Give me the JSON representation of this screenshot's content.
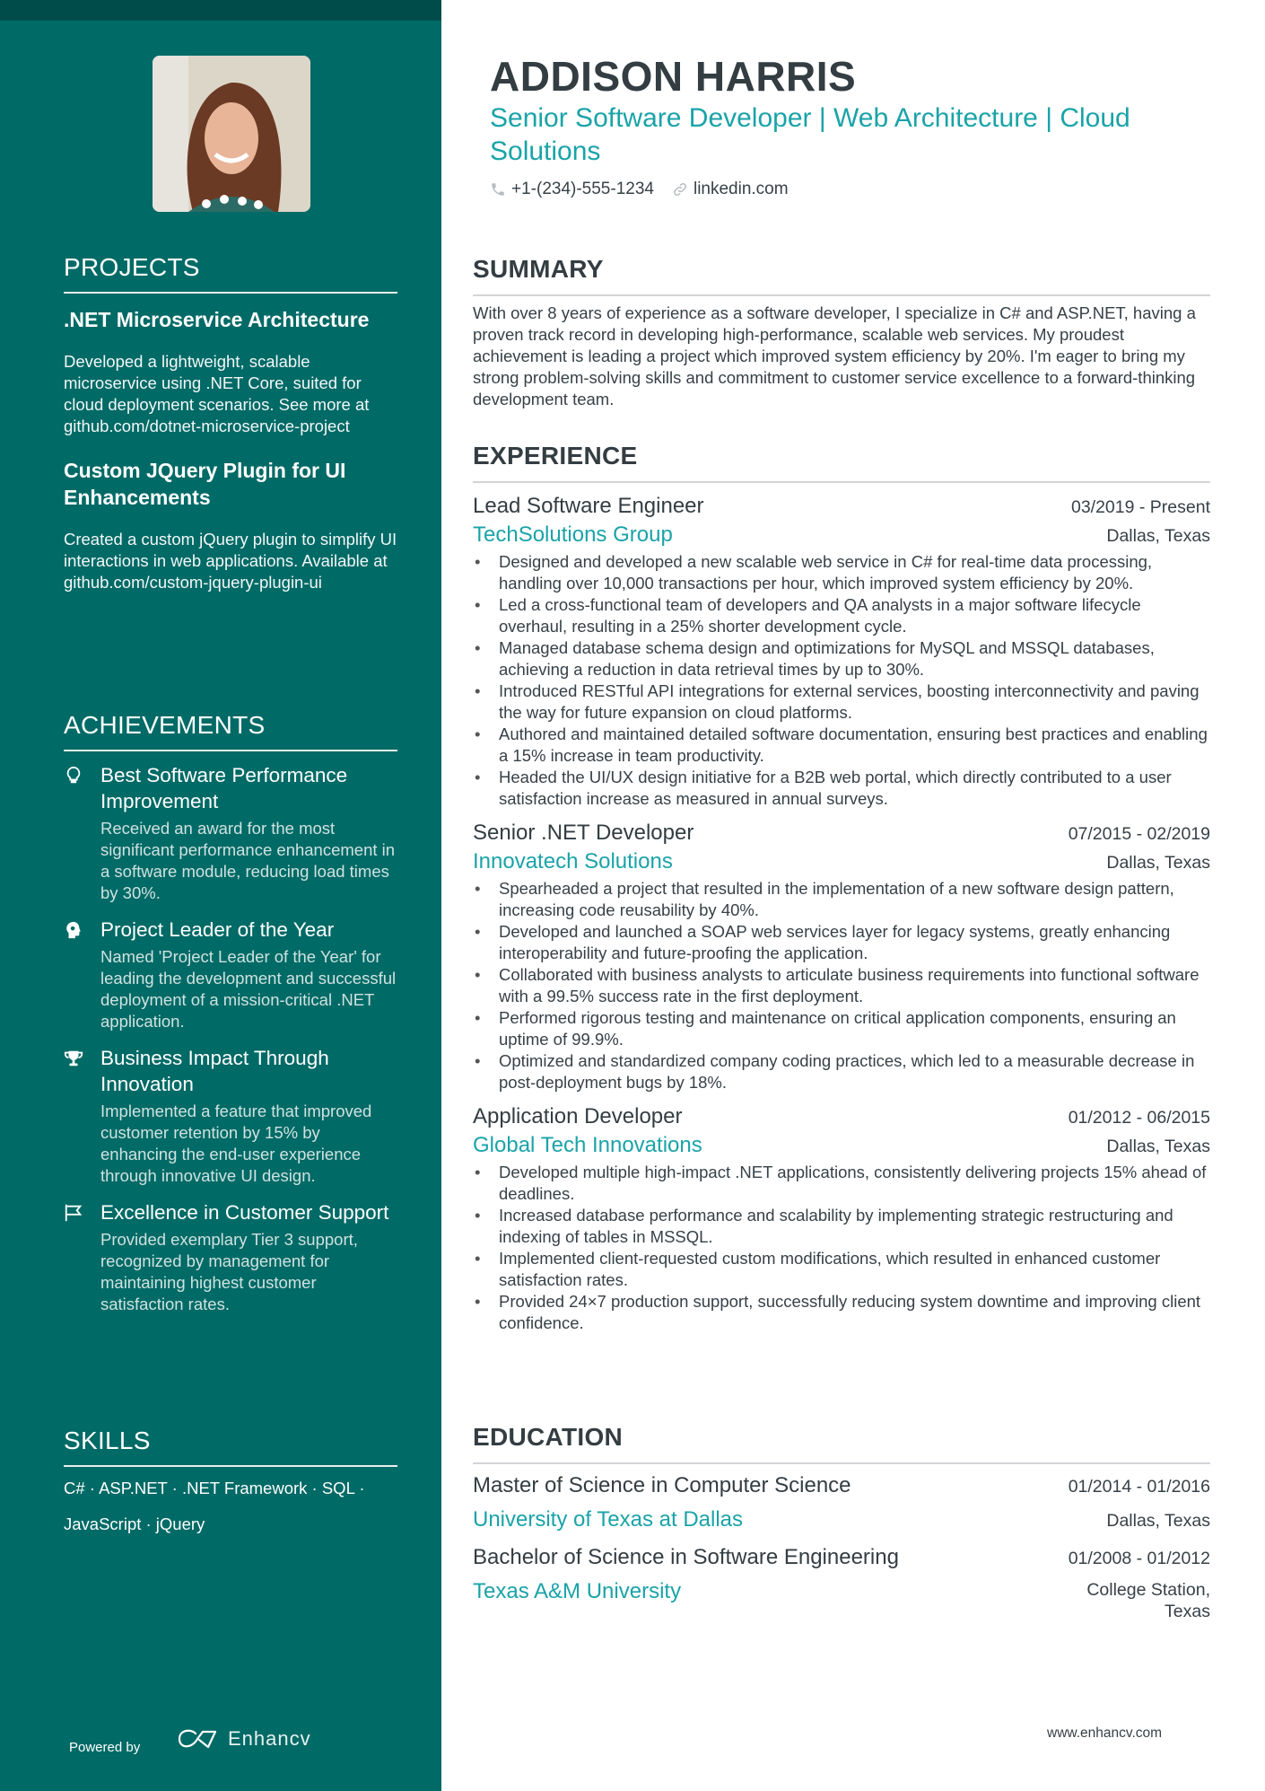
{
  "sidebar": {
    "projects": {
      "heading": "PROJECTS",
      "items": [
        {
          "title": ".NET Microservice Architecture",
          "description": "Developed a lightweight, scalable microservice using .NET Core, suited for cloud deployment scenarios. See more at github.com/dotnet-microservice-project"
        },
        {
          "title": "Custom JQuery Plugin for UI Enhancements",
          "description": "Created a custom jQuery plugin to simplify UI interactions in web applications. Available at github.com/custom-jquery-plugin-ui"
        }
      ]
    },
    "achievements": {
      "heading": "ACHIEVEMENTS",
      "items": [
        {
          "icon": "lightbulb-icon",
          "title": "Best Software Performance Improvement",
          "description": "Received an award for the most significant performance enhancement in a software module, reducing load times by 30%."
        },
        {
          "icon": "head-icon",
          "title": "Project Leader of the Year",
          "description": "Named 'Project Leader of the Year' for leading the development and successful deployment of a mission-critical .NET application."
        },
        {
          "icon": "trophy-icon",
          "title": "Business Impact Through Innovation",
          "description": "Implemented a feature that improved customer retention by 15% by enhancing the end-user experience through innovative UI design."
        },
        {
          "icon": "flag-icon",
          "title": "Excellence in Customer Support",
          "description": "Provided exemplary Tier 3 support, recognized by management for maintaining highest customer satisfaction rates."
        }
      ]
    },
    "skills": {
      "heading": "SKILLS",
      "line1": "C# · ASP.NET · .NET Framework · SQL ·",
      "line2": "JavaScript · jQuery"
    },
    "powered_by": "Powered by",
    "brand": "Enhancv"
  },
  "header": {
    "name": "ADDISON HARRIS",
    "subtitle": "Senior Software Developer | Web Architecture | Cloud Solutions",
    "phone": "+1-(234)-555-1234",
    "link": "linkedin.com"
  },
  "summary": {
    "heading": "SUMMARY",
    "text": "With over 8 years of experience as a software developer, I specialize in C# and ASP.NET, having a proven track record in developing high-performance, scalable web services. My proudest achievement is leading a project which improved system efficiency by 20%. I'm eager to bring my strong problem-solving skills and commitment to customer service excellence to a forward-thinking development team."
  },
  "experience": {
    "heading": "EXPERIENCE",
    "jobs": [
      {
        "title": "Lead Software Engineer",
        "dates": "03/2019 - Present",
        "company": "TechSolutions Group",
        "location": "Dallas, Texas",
        "bullets": [
          "Designed and developed a new scalable web service in C# for real-time data processing, handling over 10,000 transactions per hour, which improved system efficiency by 20%.",
          "Led a cross-functional team of developers and QA analysts in a major software lifecycle overhaul, resulting in a 25% shorter development cycle.",
          "Managed database schema design and optimizations for MySQL and MSSQL databases, achieving a reduction in data retrieval times by up to 30%.",
          "Introduced RESTful API integrations for external services, boosting interconnectivity and paving the way for future expansion on cloud platforms.",
          "Authored and maintained detailed software documentation, ensuring best practices and enabling a 15% increase in team productivity.",
          "Headed the UI/UX design initiative for a B2B web portal, which directly contributed to a user satisfaction increase as measured in annual surveys."
        ]
      },
      {
        "title": "Senior .NET Developer",
        "dates": "07/2015 - 02/2019",
        "company": "Innovatech Solutions",
        "location": "Dallas, Texas",
        "bullets": [
          "Spearheaded a project that resulted in the implementation of a new software design pattern, increasing code reusability by 40%.",
          "Developed and launched a SOAP web services layer for legacy systems, greatly enhancing interoperability and future-proofing the application.",
          "Collaborated with business analysts to articulate business requirements into functional software with a 99.5% success rate in the first deployment.",
          "Performed rigorous testing and maintenance on critical application components, ensuring an uptime of 99.9%.",
          "Optimized and standardized company coding practices, which led to a measurable decrease in post-deployment bugs by 18%."
        ]
      },
      {
        "title": "Application Developer",
        "dates": "01/2012 - 06/2015",
        "company": "Global Tech Innovations",
        "location": "Dallas, Texas",
        "bullets": [
          "Developed multiple high-impact .NET applications, consistently delivering projects 15% ahead of deadlines.",
          "Increased database performance and scalability by implementing strategic restructuring and indexing of tables in MSSQL.",
          "Implemented client-requested custom modifications, which resulted in enhanced customer satisfaction rates.",
          "Provided 24×7 production support, successfully reducing system downtime and improving client confidence."
        ]
      }
    ]
  },
  "education": {
    "heading": "EDUCATION",
    "items": [
      {
        "degree": "Master of Science in Computer Science",
        "dates": "01/2014 - 01/2016",
        "school": "University of Texas at Dallas",
        "location": "Dallas, Texas"
      },
      {
        "degree": "Bachelor of Science in Software Engineering",
        "dates": "01/2008 - 01/2012",
        "school": "Texas A&M University",
        "location_line1": "College Station,",
        "location_line2": "Texas"
      }
    ]
  },
  "footer": {
    "url": "www.enhancv.com"
  },
  "colors": {
    "sidebar": "#006a66",
    "sidebar_top": "#004c4b",
    "accent": "#1aa3a8",
    "text": "#374147"
  }
}
